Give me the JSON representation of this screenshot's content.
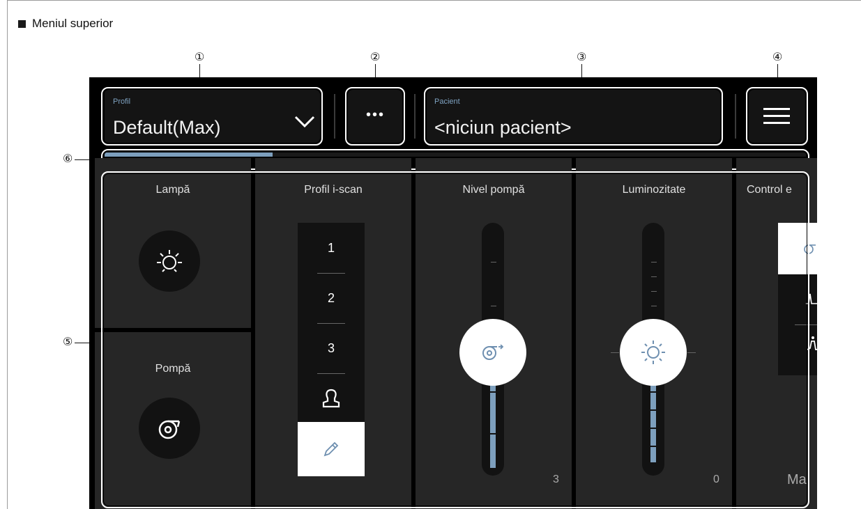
{
  "caption": {
    "text": "Meniul superior"
  },
  "callouts": {
    "c1": "①",
    "c2": "②",
    "c3": "③",
    "c4": "④",
    "c5": "⑤",
    "c6": "⑥"
  },
  "topbar": {
    "profile_label": "Profil",
    "profile_value": "Default(Max)",
    "more_glyph": "•••",
    "patient_label": "Pacient",
    "patient_value": "<niciun pacient>"
  },
  "progress": {
    "fraction": 0.24,
    "color": "#7d9fbd"
  },
  "tiles": {
    "lamp": {
      "title": "Lampă",
      "icon": "lamp-bulb-icon"
    },
    "pump": {
      "title": "Pompă",
      "icon": "pump-icon"
    },
    "iscan": {
      "title": "Profil i-scan",
      "options": [
        "1",
        "2",
        "3"
      ],
      "user_icon": "user-profile-icon",
      "edit_icon": "pencil-icon"
    },
    "pump_level": {
      "title": "Nivel pompă",
      "value": "3",
      "icon": "pump-icon"
    },
    "brightness": {
      "title": "Luminozitate",
      "value": "0",
      "icon": "brightness-sun-icon"
    },
    "control": {
      "title": "Control e",
      "footer": "Ma"
    }
  },
  "colors": {
    "accent": "#7d9fbd",
    "screen_bg": "#000000",
    "tile_bg": "#262626"
  }
}
